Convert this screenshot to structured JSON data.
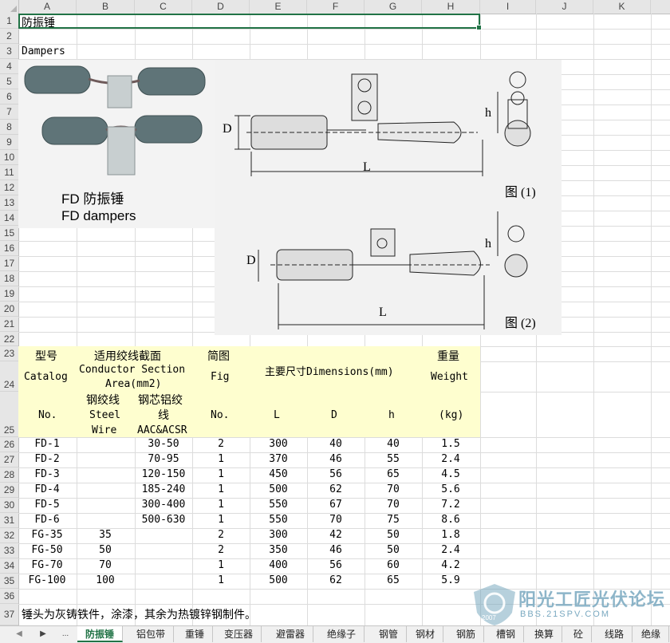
{
  "columns": [
    "A",
    "B",
    "C",
    "D",
    "E",
    "F",
    "G",
    "H",
    "I",
    "J",
    "K"
  ],
  "rows": [
    "1",
    "2",
    "3",
    "4",
    "5",
    "6",
    "7",
    "8",
    "9",
    "10",
    "11",
    "12",
    "13",
    "14",
    "15",
    "16",
    "17",
    "18",
    "19",
    "20",
    "21",
    "22",
    "23",
    "24",
    "25",
    "26",
    "27",
    "28",
    "29",
    "30",
    "31",
    "32",
    "33",
    "34",
    "35",
    "36",
    "37"
  ],
  "cells": {
    "a1": "防振锤",
    "a3": "Dampers"
  },
  "photo": {
    "label_cn": "FD 防振锤",
    "label_en": "FD dampers"
  },
  "drawing": {
    "D": "D",
    "L": "L",
    "h": "h",
    "fig1": "图 (1)",
    "fig2": "图 (2)"
  },
  "table": {
    "h23": [
      "型号",
      "适用绞线截面",
      "简图",
      "重量"
    ],
    "h24": [
      "Catalog",
      "Conductor Section",
      "Fig",
      "主要尺寸Dimensions(mm)",
      "Weight"
    ],
    "h24b": "Area(mm2)",
    "h25": [
      "No.",
      "钢绞线",
      "钢芯铝绞",
      "No.",
      "L",
      "D",
      "h",
      "(kg)"
    ],
    "h25b": [
      "Steel",
      "线"
    ],
    "h25c": [
      "Wire",
      "AAC&ACSR"
    ],
    "rows": [
      [
        "FD-1",
        "",
        "30-50",
        "2",
        "300",
        "40",
        "40",
        "1.5"
      ],
      [
        "FD-2",
        "",
        "70-95",
        "1",
        "370",
        "46",
        "55",
        "2.4"
      ],
      [
        "FD-3",
        "",
        "120-150",
        "1",
        "450",
        "56",
        "65",
        "4.5"
      ],
      [
        "FD-4",
        "",
        "185-240",
        "1",
        "500",
        "62",
        "70",
        "5.6"
      ],
      [
        "FD-5",
        "",
        "300-400",
        "1",
        "550",
        "67",
        "70",
        "7.2"
      ],
      [
        "FD-6",
        "",
        "500-630",
        "1",
        "550",
        "70",
        "75",
        "8.6"
      ],
      [
        "FG-35",
        "35",
        "",
        "2",
        "300",
        "42",
        "50",
        "1.8"
      ],
      [
        "FG-50",
        "50",
        "",
        "2",
        "350",
        "46",
        "50",
        "2.4"
      ],
      [
        "FG-70",
        "70",
        "",
        "1",
        "400",
        "56",
        "60",
        "4.2"
      ],
      [
        "FG-100",
        "100",
        "",
        "1",
        "500",
        "62",
        "65",
        "5.9"
      ]
    ]
  },
  "note": "锤头为灰铸铁件，涂漆，其余为热镀锌钢制件。",
  "tabs": [
    "防振锤",
    "铝包带",
    "重锤",
    "变压器",
    "避雷器",
    "绝缘子",
    "钢管",
    "钢材",
    "钢筋",
    "槽钢",
    "换算",
    "砼",
    "线路",
    "绝缘"
  ],
  "nav": {
    "prev": "◀",
    "next": "▶",
    "more": "..."
  },
  "watermark": {
    "title": "阳光工匠光伏论坛",
    "url": "BBS.21SPV.COM",
    "year": "2007"
  }
}
